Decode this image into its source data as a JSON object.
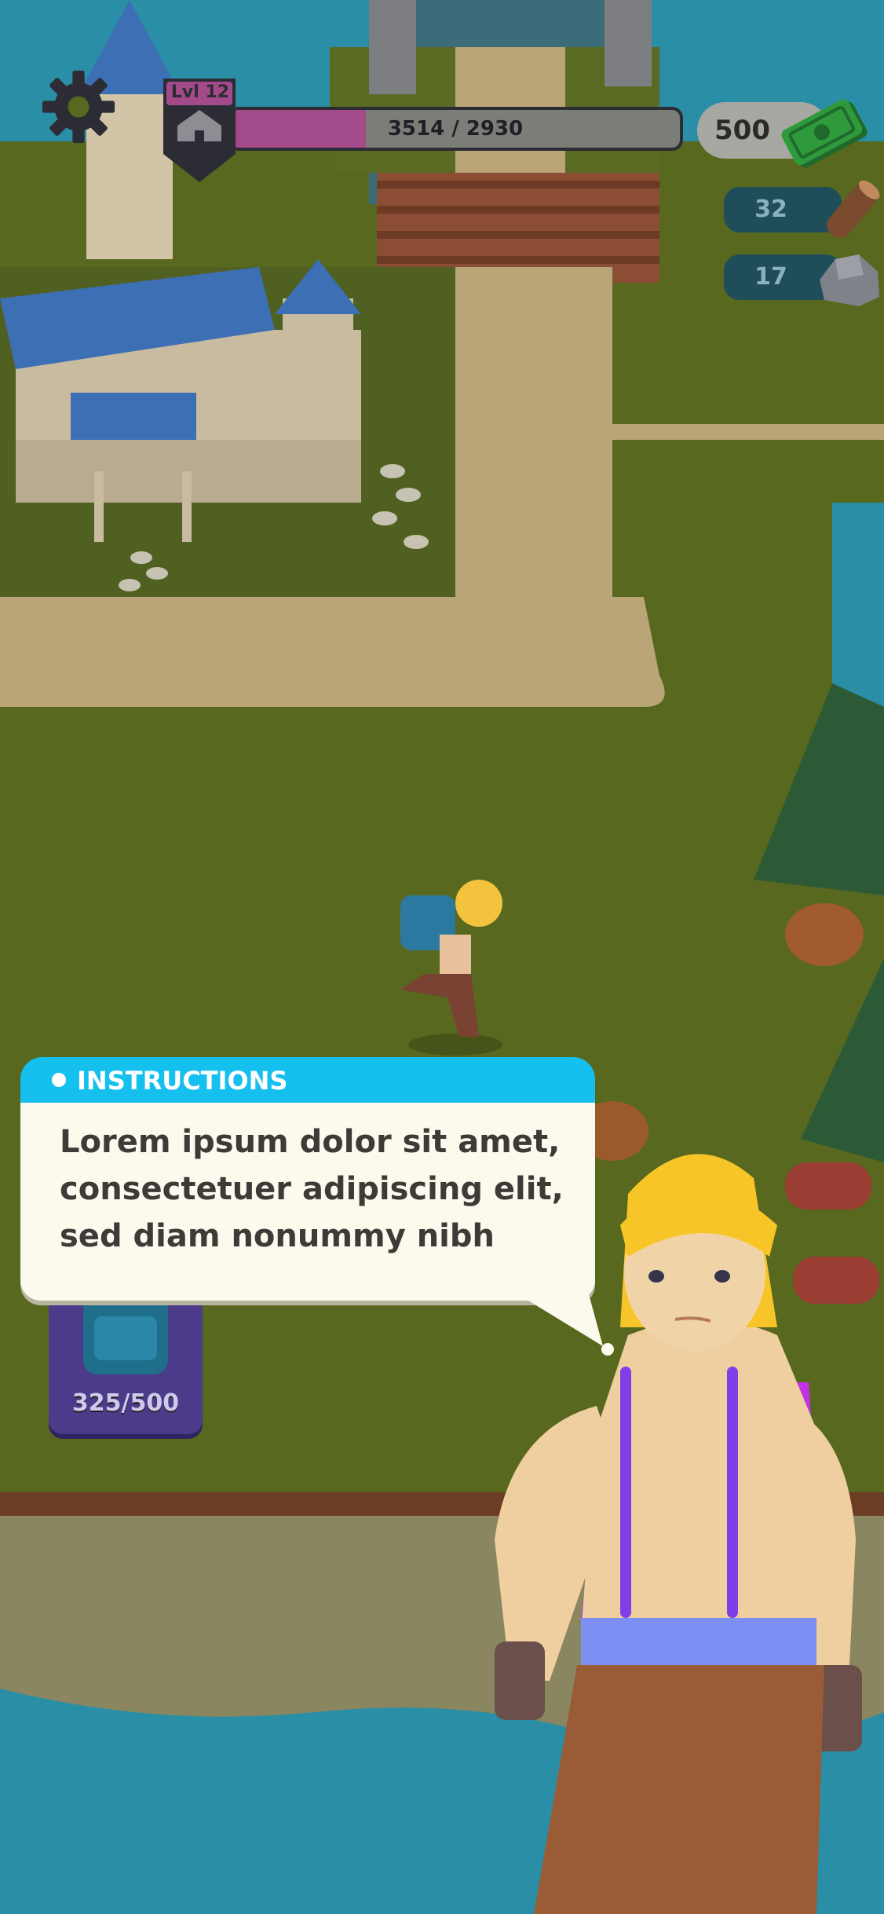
{
  "hud": {
    "level_label": "Lvl 12",
    "xp_text": "3514 / 2930",
    "xp_progress": 0.3,
    "money": "500",
    "wood": "32",
    "stone": "17",
    "backpack_capacity": "325/500"
  },
  "instructions": {
    "title": "INSTRUCTIONS",
    "lines": [
      "Lorem ipsum dolor sit amet,",
      "consectetuer adipiscing elit,",
      "sed diam nonummy nibh"
    ]
  },
  "icons": {
    "settings": "gear-icon",
    "level": "house-icon",
    "money": "cash-icon",
    "wood": "log-icon",
    "stone": "rock-icon",
    "backpack": "backpack-icon"
  },
  "colors": {
    "grass": "#5a6a22",
    "path": "#b9a577",
    "water": "#2a8fa6",
    "accent": "#15c0ef",
    "xp_fill": "#a24a8a",
    "backpack_card": "#4c3a8a"
  }
}
